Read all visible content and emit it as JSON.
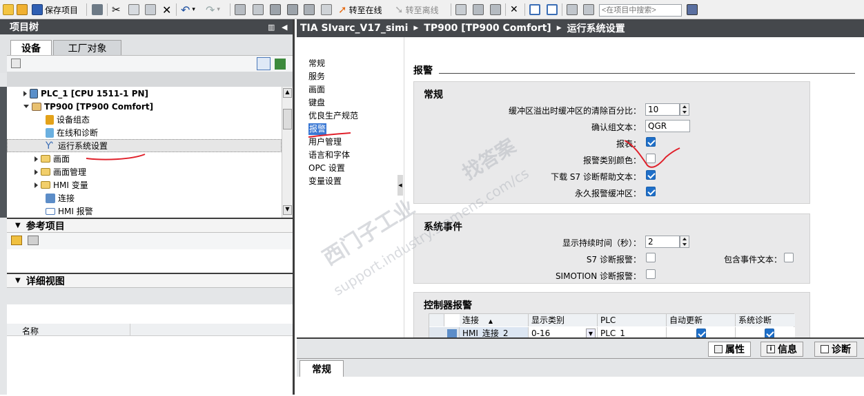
{
  "toolbar": {
    "save_project": "保存项目",
    "go_online": "转至在线",
    "go_offline": "转至离线",
    "search_placeholder": "<在项目中搜索>"
  },
  "project_tree": {
    "title": "项目树",
    "tabs": [
      "设备",
      "工厂对象"
    ],
    "items": [
      {
        "label": "PLC_1 [CPU 1511-1 PN]",
        "icon": "plc-icon"
      },
      {
        "label": "TP900 [TP900 Comfort]",
        "icon": "hmi-device-icon"
      },
      {
        "label": "设备组态",
        "icon": "device-config-icon"
      },
      {
        "label": "在线和诊断",
        "icon": "online-diagnostics-icon"
      },
      {
        "label": "运行系统设置",
        "icon": "runtime-settings-icon"
      },
      {
        "label": "画面",
        "icon": "folder-icon"
      },
      {
        "label": "画面管理",
        "icon": "folder-icon"
      },
      {
        "label": "HMI 变量",
        "icon": "folder-icon"
      },
      {
        "label": "连接",
        "icon": "connection-icon"
      },
      {
        "label": "HMI 报警",
        "icon": "alarm-icon"
      }
    ]
  },
  "reference_panel": {
    "title": "参考项目"
  },
  "detail_panel": {
    "title": "详细视图",
    "column_name": "名称"
  },
  "breadcrumb": [
    "TIA  SIvarc_V17_simi",
    "TP900 [TP900 Comfort]",
    "运行系统设置"
  ],
  "settings_nav": [
    "常规",
    "服务",
    "画面",
    "键盘",
    "优良生产规范",
    "报警",
    "用户管理",
    "语言和字体",
    "OPC 设置",
    "变量设置"
  ],
  "alarms": {
    "heading": "报警",
    "general": {
      "title": "常规",
      "buffer_overflow_label": "缓冲区溢出时缓冲区的清除百分比：",
      "buffer_overflow_value": "10",
      "ack_text_label": "确认组文本：",
      "ack_text_value": "QGR",
      "report_label": "报表：",
      "report_checked": true,
      "class_colors_label": "报警类别颜色：",
      "class_colors_checked": false,
      "s7_help_label": "下载 S7 诊断帮助文本：",
      "s7_help_checked": true,
      "persistent_label": "永久报警缓冲区：",
      "persistent_checked": true
    },
    "system_events": {
      "title": "系统事件",
      "duration_label": "显示持续时间（秒）：",
      "duration_value": "2",
      "s7_diag_label": "S7 诊断报警：",
      "s7_diag_checked": false,
      "include_event_label": "包含事件文本：",
      "include_event_checked": false,
      "simotion_label": "SIMOTION 诊断报警：",
      "simotion_checked": false
    },
    "controller_alarms": {
      "title": "控制器报警",
      "columns": [
        "连接",
        "显示类别",
        "PLC",
        "自动更新",
        "系统诊断"
      ],
      "rows": [
        {
          "connection": "HMI_连接_2",
          "display_class": "0-16",
          "plc": "PLC_1",
          "auto_update": true,
          "system_diag": true
        }
      ]
    }
  },
  "inspector": {
    "tabs": [
      "属性",
      "信息",
      "诊断"
    ],
    "subtab": "常规"
  },
  "watermark": [
    "西门子工业",
    "support.industry.siemens.com/cs",
    "找答案"
  ],
  "colors": {
    "title_bar": "#45484c",
    "checkbox_on": "#1e6fc9",
    "annotation_red": "#e0202a"
  }
}
